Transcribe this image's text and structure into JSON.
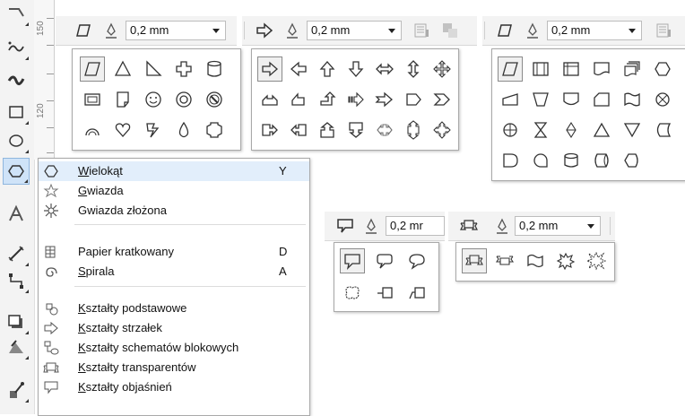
{
  "ruler": {
    "labels": [
      "150",
      "120"
    ]
  },
  "toolbar": {
    "outline_width": "0,2 mm",
    "outline_width_clipped": "0,2 mr"
  },
  "menu": {
    "items": [
      {
        "label": "Wielokąt",
        "shortcut": "Y"
      },
      {
        "label": "Gwiazda",
        "shortcut": ""
      },
      {
        "label": "Gwiazda złożona",
        "shortcut": ""
      },
      {
        "label": "Papier kratkowany",
        "shortcut": "D"
      },
      {
        "label": "Spirala",
        "shortcut": "A"
      },
      {
        "label": "Kształty podstawowe",
        "shortcut": ""
      },
      {
        "label": "Kształty strzałek",
        "shortcut": ""
      },
      {
        "label": "Kształty schematów blokowych",
        "shortcut": ""
      },
      {
        "label": "Kształty transparentów",
        "shortcut": ""
      },
      {
        "label": "Kształty objaśnień",
        "shortcut": ""
      }
    ]
  }
}
